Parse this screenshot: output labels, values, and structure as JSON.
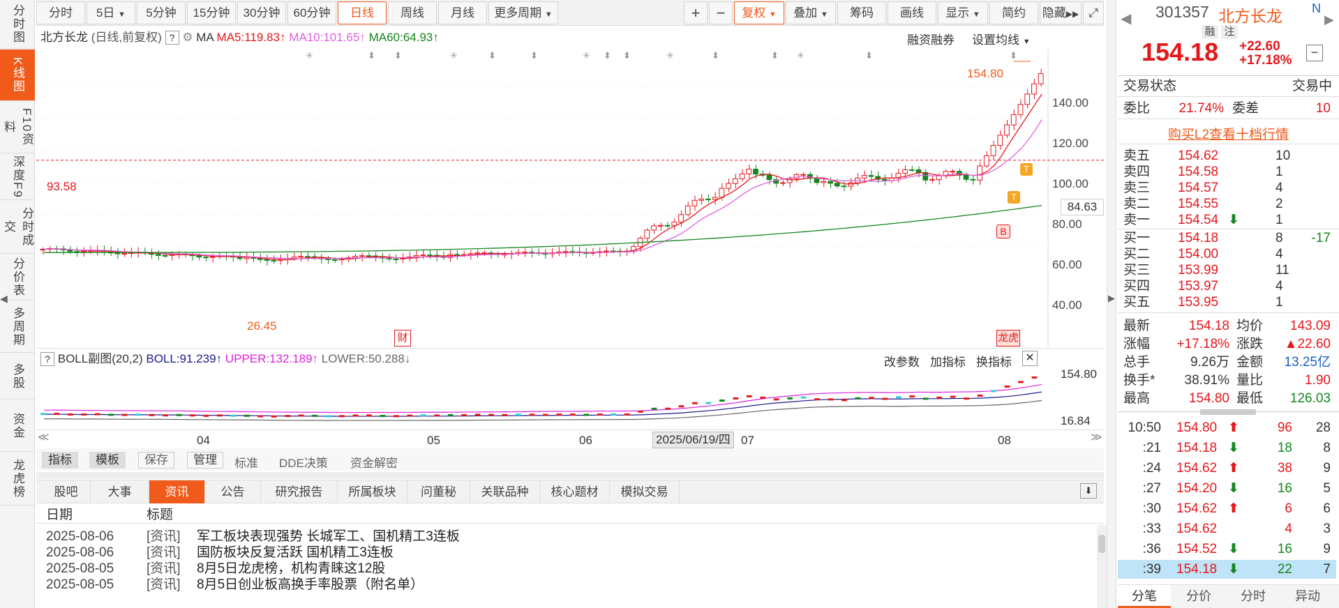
{
  "sidebar": {
    "items": [
      "分时图",
      "K线图",
      "F10资料",
      "深度F9",
      "分时成交",
      "分价表",
      "多周期",
      "多股",
      "资金",
      "龙虎榜"
    ]
  },
  "toolbar": {
    "periods": [
      "分时",
      "5日",
      "5分钟",
      "15分钟",
      "30分钟",
      "60分钟",
      "日线",
      "周线",
      "月线",
      "更多周期"
    ],
    "tools": [
      "+",
      "−",
      "复权",
      "叠加",
      "筹码",
      "画线",
      "显示",
      "简约",
      "隐藏"
    ]
  },
  "chart": {
    "title": "北方长龙",
    "mode": "(日线,前复权)",
    "ma_label": "MA",
    "ma5": "MA5:119.83",
    "ma10": "MA10:101.65",
    "ma60": "MA60:64.93",
    "margin_link": "融资融券",
    "settings": "设置均线",
    "high_label": "154.80",
    "low_label": "26.45",
    "line_label": "93.58",
    "cur_price_label": "84.63",
    "yticks": [
      "140.00",
      "120.00",
      "100.00",
      "80.00",
      "60.00",
      "40.00"
    ],
    "badge_cai": "财",
    "badge_lhb": "龙虎",
    "marker_T": "T",
    "marker_B": "B",
    "sub": {
      "title": "BOLL副图(20,2)",
      "boll": "BOLL:91.239",
      "upper": "UPPER:132.189",
      "lower": "LOWER:50.288",
      "btn_params": "改参数",
      "btn_add": "加指标",
      "btn_switch": "换指标",
      "ymax": "154.80",
      "ymin": "16.84"
    },
    "xticks": [
      "04",
      "05",
      "06",
      "07",
      "08"
    ],
    "cursor_date": "2025/06/19/四",
    "indicator_tabs": [
      "指标",
      "模板",
      "保存",
      "管理",
      "标准",
      "DDE决策",
      "资金解密"
    ]
  },
  "news": {
    "tabs": [
      "股吧",
      "大事",
      "资讯",
      "公告",
      "研究报告",
      "所属板块",
      "问董秘",
      "关联品种",
      "核心题材",
      "模拟交易"
    ],
    "header": {
      "date": "日期",
      "title": "标题"
    },
    "rows": [
      {
        "date": "2025-08-06",
        "tag": "[资讯]",
        "title": "军工板块表现强势 长城军工、国机精工3连板"
      },
      {
        "date": "2025-08-06",
        "tag": "[资讯]",
        "title": "国防板块反复活跃 国机精工3连板"
      },
      {
        "date": "2025-08-05",
        "tag": "[资讯]",
        "title": "8月5日龙虎榜，机构青睐这12股"
      },
      {
        "date": "2025-08-05",
        "tag": "[资讯]",
        "title": "8月5日创业板高换手率股票（附名单）"
      }
    ]
  },
  "quote": {
    "code": "301357",
    "name": "北方长龙",
    "tag1": "融",
    "tag2": "注",
    "price": "154.18",
    "change": "+22.60",
    "pct": "+17.18%",
    "status_label": "交易状态",
    "status": "交易中",
    "wb_label": "委比",
    "wb": "21.74%",
    "wc_label": "委差",
    "wc": "10",
    "l2": "购买L2查看十档行情",
    "sells": [
      {
        "l": "卖五",
        "p": "154.62",
        "v": "10"
      },
      {
        "l": "卖四",
        "p": "154.58",
        "v": "1"
      },
      {
        "l": "卖三",
        "p": "154.57",
        "v": "4"
      },
      {
        "l": "卖二",
        "p": "154.55",
        "v": "2"
      },
      {
        "l": "卖一",
        "p": "154.54",
        "v": "1"
      }
    ],
    "buys": [
      {
        "l": "买一",
        "p": "154.18",
        "v": "8",
        "d": "-17"
      },
      {
        "l": "买二",
        "p": "154.00",
        "v": "4",
        "d": ""
      },
      {
        "l": "买三",
        "p": "153.99",
        "v": "11",
        "d": ""
      },
      {
        "l": "买四",
        "p": "153.97",
        "v": "4",
        "d": ""
      },
      {
        "l": "买五",
        "p": "153.95",
        "v": "1",
        "d": ""
      }
    ],
    "stats": [
      {
        "a": "最新",
        "av": "154.18",
        "b": "均价",
        "bv": "143.09"
      },
      {
        "a": "涨幅",
        "av": "+17.18%",
        "b": "涨跌",
        "bv": "▲22.60"
      },
      {
        "a": "总手",
        "av": "9.26万",
        "b": "金额",
        "bv": "13.25亿"
      },
      {
        "a": "换手*",
        "av": "38.91%",
        "b": "量比",
        "bv": "1.90"
      },
      {
        "a": "最高",
        "av": "154.80",
        "b": "最低",
        "bv": "126.03"
      }
    ],
    "ticks": [
      {
        "t": "10:50",
        "p": "154.80",
        "dir": "up",
        "v": "96",
        "n": "28"
      },
      {
        "t": ":21",
        "p": "154.18",
        "dir": "down",
        "v": "18",
        "n": "8"
      },
      {
        "t": ":24",
        "p": "154.62",
        "dir": "up",
        "v": "38",
        "n": "9"
      },
      {
        "t": ":27",
        "p": "154.20",
        "dir": "down",
        "v": "16",
        "n": "5"
      },
      {
        "t": ":30",
        "p": "154.62",
        "dir": "up",
        "v": "6",
        "n": "6"
      },
      {
        "t": ":33",
        "p": "154.62",
        "dir": "",
        "v": "4",
        "n": "3"
      },
      {
        "t": ":36",
        "p": "154.52",
        "dir": "down",
        "v": "16",
        "n": "9"
      },
      {
        "t": ":39",
        "p": "154.18",
        "dir": "down",
        "v": "22",
        "n": "7"
      }
    ],
    "bottom_tabs": [
      "分笔",
      "分价",
      "分时",
      "异动"
    ]
  }
}
